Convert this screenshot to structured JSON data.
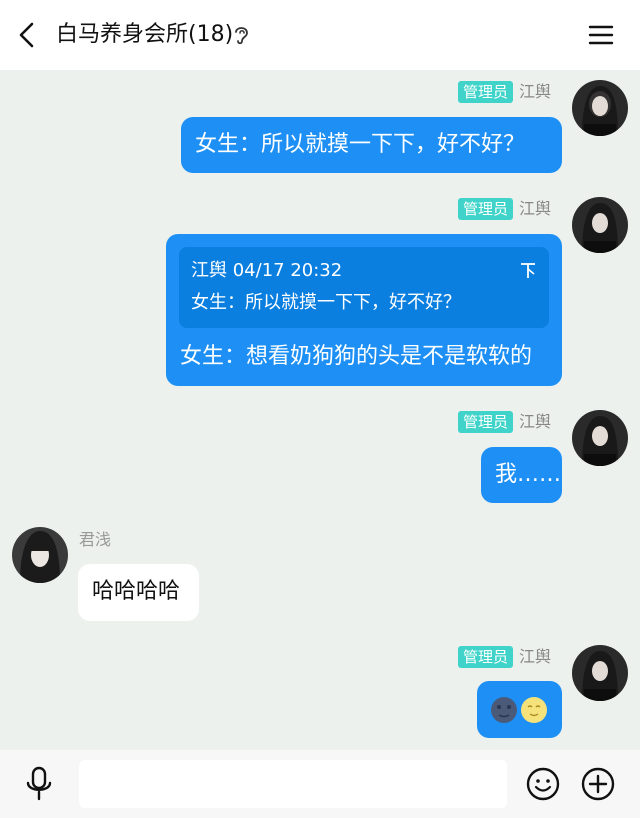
{
  "header": {
    "title": "白马养身会所(18)",
    "back_icon": "chevron-left-icon",
    "ear_icon": "ear-icon",
    "menu_icon": "hamburger-menu-icon"
  },
  "messages": [
    {
      "badge": "管理员",
      "sender": "江舆",
      "text": "女生：所以就摸一下下，好不好？"
    },
    {
      "badge": "管理员",
      "sender": "江舆",
      "quote_header": "江舆 04/17 20:32",
      "quote_text": "女生：所以就摸一下下，好不好？",
      "text": "女生：想看奶狗狗的头是不是软软的"
    },
    {
      "badge": "管理员",
      "sender": "江舆",
      "text": "我……"
    },
    {
      "sender": "君浅",
      "text": "哈哈哈哈"
    },
    {
      "badge": "管理员",
      "sender": "江舆",
      "emojis": [
        "new-moon-face-emoji",
        "crescent-moon-face-emoji"
      ]
    }
  ],
  "footer": {
    "input_value": "",
    "mic_icon": "microphone-icon",
    "emoji_icon": "smiley-icon",
    "plus_icon": "plus-circle-icon"
  },
  "colors": {
    "background": "#edf1ee",
    "bubble_out": "#1e90f5",
    "quote_bg": "#0b7fe0",
    "badge": "#3fd3c9"
  }
}
